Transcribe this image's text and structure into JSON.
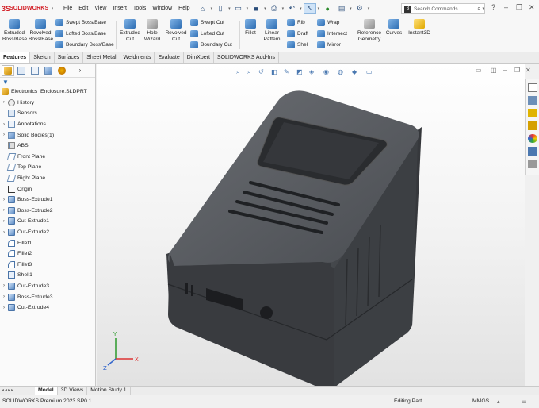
{
  "app": {
    "brand_prefix": "3S",
    "brand": "SOLIDWORKS"
  },
  "menu": [
    "File",
    "Edit",
    "View",
    "Insert",
    "Tools",
    "Window",
    "Help"
  ],
  "search": {
    "placeholder": "Search Commands"
  },
  "ribbon": {
    "extruded_boss": "Extruded Boss/Base",
    "revolved_boss": "Revolved Boss/Base",
    "swept_boss": "Swept Boss/Base",
    "lofted_boss": "Lofted Boss/Base",
    "boundary_boss": "Boundary Boss/Base",
    "extruded_cut": "Extruded Cut",
    "hole_wizard": "Hole Wizard",
    "revolved_cut": "Revolved Cut",
    "swept_cut": "Swept Cut",
    "lofted_cut": "Lofted Cut",
    "boundary_cut": "Boundary Cut",
    "fillet": "Fillet",
    "linear_pattern": "Linear Pattern",
    "rib": "Rib",
    "draft": "Draft",
    "shell": "Shell",
    "wrap": "Wrap",
    "intersect": "Intersect",
    "mirror": "Mirror",
    "reference_geometry": "Reference Geometry",
    "curves": "Curves",
    "instant3d": "Instant3D"
  },
  "tabs": [
    "Features",
    "Sketch",
    "Surfaces",
    "Sheet Metal",
    "Weldments",
    "Evaluate",
    "DimXpert",
    "SOLIDWORKS Add-Ins"
  ],
  "tree": {
    "root": "Electronics_Enclosure.SLDPRT",
    "items": [
      {
        "label": "History",
        "icon": "history-icon",
        "expand": "›"
      },
      {
        "label": "Sensors",
        "icon": "sensors-icon",
        "expand": ""
      },
      {
        "label": "Annotations",
        "icon": "annotations-icon",
        "expand": "›"
      },
      {
        "label": "Solid Bodies(1)",
        "icon": "solid-bodies-icon",
        "expand": "›"
      },
      {
        "label": "ABS",
        "icon": "material-icon",
        "expand": ""
      },
      {
        "label": "Front Plane",
        "icon": "plane-icon",
        "expand": ""
      },
      {
        "label": "Top Plane",
        "icon": "plane-icon",
        "expand": ""
      },
      {
        "label": "Right Plane",
        "icon": "plane-icon",
        "expand": ""
      },
      {
        "label": "Origin",
        "icon": "origin-icon",
        "expand": ""
      },
      {
        "label": "Boss-Extrude1",
        "icon": "extrude-icon",
        "expand": "›"
      },
      {
        "label": "Boss-Extrude2",
        "icon": "extrude-icon",
        "expand": "›"
      },
      {
        "label": "Cut-Extrude1",
        "icon": "cut-icon",
        "expand": "›"
      },
      {
        "label": "Cut-Extrude2",
        "icon": "cut-icon",
        "expand": "›"
      },
      {
        "label": "Fillet1",
        "icon": "fillet-icon",
        "expand": ""
      },
      {
        "label": "Fillet2",
        "icon": "fillet-icon",
        "expand": ""
      },
      {
        "label": "Fillet3",
        "icon": "fillet-icon",
        "expand": ""
      },
      {
        "label": "Shell1",
        "icon": "shell-icon",
        "expand": ""
      },
      {
        "label": "Cut-Extrude3",
        "icon": "cut-icon",
        "expand": "›"
      },
      {
        "label": "Boss-Extrude3",
        "icon": "extrude-icon",
        "expand": "›"
      },
      {
        "label": "Cut-Extrude4",
        "icon": "cut-icon",
        "expand": "›"
      }
    ]
  },
  "bottom_tabs": [
    "Model",
    "3D Views",
    "Motion Study 1"
  ],
  "status": {
    "version": "SOLIDWORKS Premium 2023 SP0.1",
    "mode": "Editing Part",
    "units": "MMGS"
  },
  "triad": {
    "x": "X",
    "y": "Y",
    "z": "Z"
  },
  "colors": {
    "brand": "#d32027",
    "accent": "#2d6db3",
    "body": "#4a4d52"
  }
}
